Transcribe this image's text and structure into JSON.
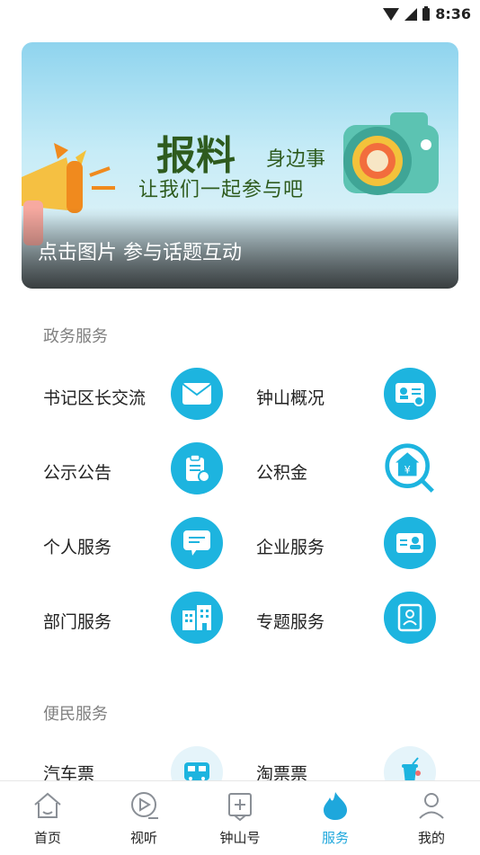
{
  "status_bar": {
    "time": "8:36"
  },
  "banner": {
    "title": "报料",
    "subtitle1": "身边事",
    "subtitle2": "让我们一起参与吧",
    "caption": "点击图片  参与话题互动"
  },
  "sections": [
    {
      "title": "政务服务",
      "items": [
        {
          "label": "书记区长交流",
          "icon": "envelope-icon"
        },
        {
          "label": "钟山概况",
          "icon": "id-card-icon"
        },
        {
          "label": "公示公告",
          "icon": "clipboard-icon"
        },
        {
          "label": "公积金",
          "icon": "house-search-icon"
        },
        {
          "label": "个人服务",
          "icon": "chat-bubble-icon"
        },
        {
          "label": "企业服务",
          "icon": "business-card-icon"
        },
        {
          "label": "部门服务",
          "icon": "building-icon"
        },
        {
          "label": "专题服务",
          "icon": "profile-frame-icon"
        }
      ]
    },
    {
      "title": "便民服务",
      "items": [
        {
          "label": "汽车票",
          "icon": "bus-icon"
        },
        {
          "label": "淘票票",
          "icon": "drink-cup-icon"
        }
      ]
    }
  ],
  "tabbar": {
    "items": [
      {
        "label": "首页",
        "icon": "home-icon"
      },
      {
        "label": "视听",
        "icon": "play-icon"
      },
      {
        "label": "钟山号",
        "icon": "plus-doc-icon"
      },
      {
        "label": "服务",
        "icon": "flame-icon",
        "active": true
      },
      {
        "label": "我的",
        "icon": "user-icon"
      }
    ],
    "active_color": "#1ea7dc"
  },
  "colors": {
    "accent": "#1db4df",
    "banner_text": "#2e5b1e"
  }
}
